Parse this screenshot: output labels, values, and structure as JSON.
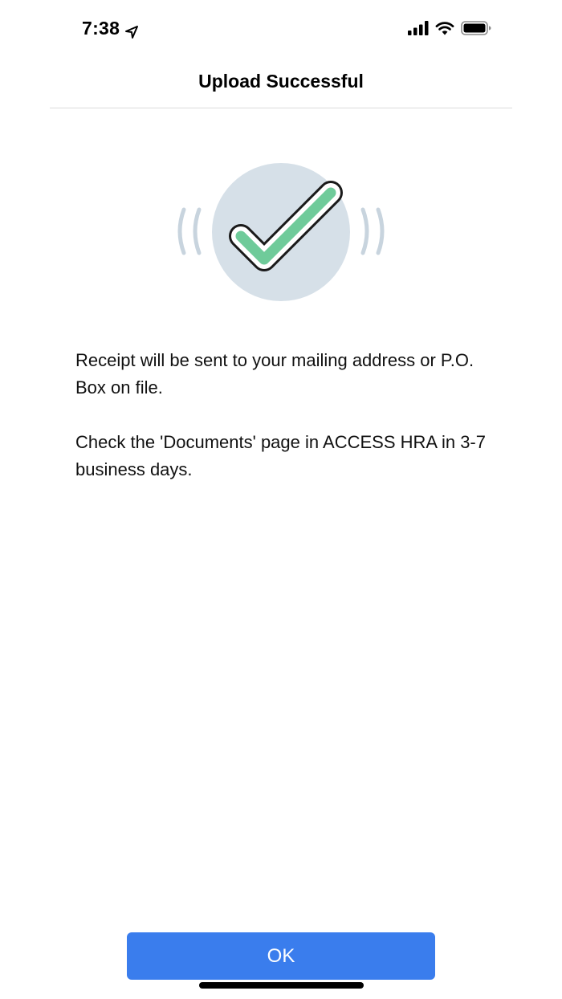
{
  "status_bar": {
    "time": "7:38",
    "location_icon": "location-arrow-icon",
    "signal_icon": "cellular-signal-icon",
    "wifi_icon": "wifi-icon",
    "battery_icon": "battery-icon"
  },
  "nav": {
    "title": "Upload Successful"
  },
  "illustration": {
    "icon": "checkmark-success-icon",
    "circle_color": "#d6e0e8",
    "check_color": "#6fcb9a",
    "wave_color": "#c8d4de"
  },
  "messages": [
    "Receipt will be sent to your mailing address or P.O. Box on file.",
    "Check the 'Documents' page in ACCESS HRA in 3-7 business days."
  ],
  "actions": {
    "ok_label": "OK",
    "ok_color": "#3a7ded"
  }
}
